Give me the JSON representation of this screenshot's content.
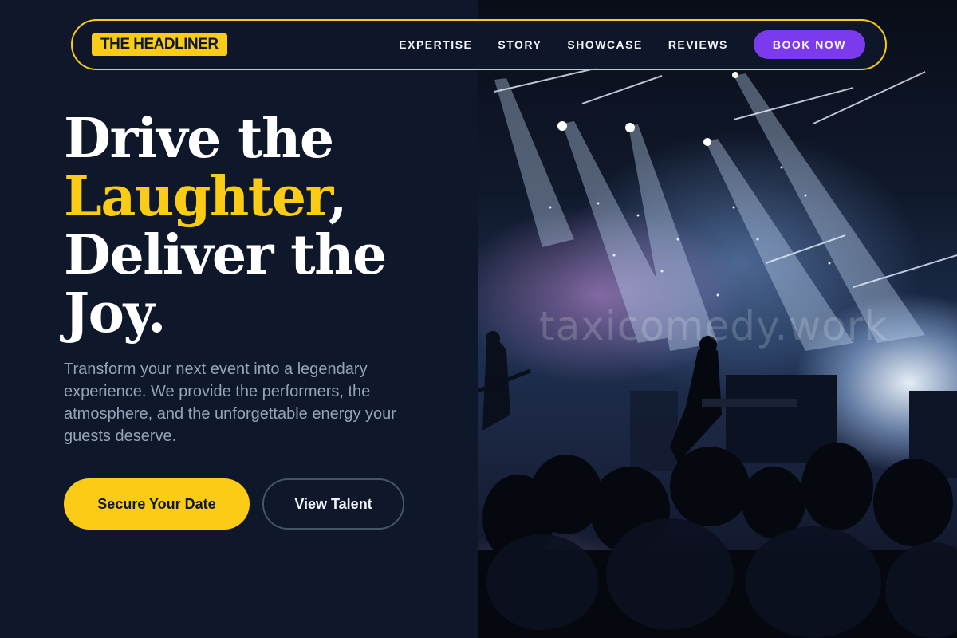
{
  "brand": {
    "logo_text": "THE HEADLINER"
  },
  "nav": {
    "links": [
      "EXPERTISE",
      "STORY",
      "SHOWCASE",
      "REVIEWS"
    ],
    "cta_label": "BOOK NOW"
  },
  "hero": {
    "headline_line1": "Drive the",
    "headline_accent": "Laughter",
    "headline_comma": ",",
    "headline_line3": "Deliver the",
    "headline_line4": "Joy.",
    "description": "Transform your next event into a legendary experience. We provide the performers, the atmosphere, and the unforgettable energy your guests deserve.",
    "primary_cta": "Secure Your Date",
    "secondary_cta": "View Talent"
  },
  "image": {
    "watermark": "taxicomedy.work"
  },
  "colors": {
    "background": "#0f172a",
    "accent_yellow": "#facc15",
    "accent_purple": "#7c3aed",
    "muted_text": "#94a3b8"
  }
}
